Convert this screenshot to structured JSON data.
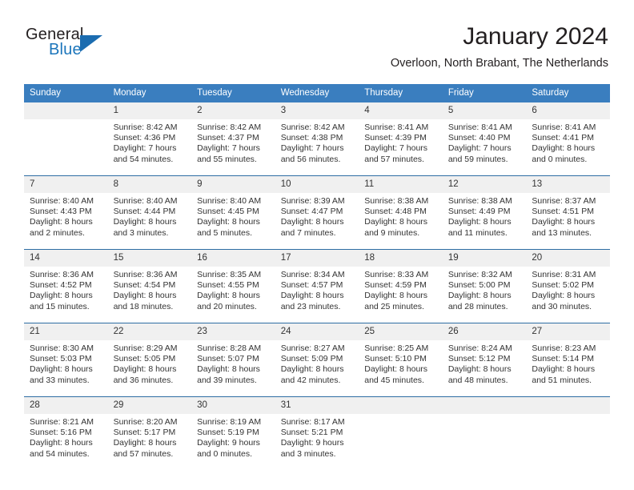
{
  "brand": {
    "name_part1": "General",
    "name_part2": "Blue"
  },
  "header": {
    "month_title": "January 2024",
    "location": "Overloon, North Brabant, The Netherlands"
  },
  "colors": {
    "header_blue": "#3a7ebf",
    "separator_blue": "#2e6da4",
    "date_band_gray": "#f0f0f0",
    "brand_blue": "#1b75bb"
  },
  "calendar": {
    "weekday_headers": [
      "Sunday",
      "Monday",
      "Tuesday",
      "Wednesday",
      "Thursday",
      "Friday",
      "Saturday"
    ],
    "weeks": [
      {
        "days": [
          {
            "date": "",
            "sunrise": "",
            "sunset": "",
            "daylight_line1": "",
            "daylight_line2": ""
          },
          {
            "date": "1",
            "sunrise": "Sunrise: 8:42 AM",
            "sunset": "Sunset: 4:36 PM",
            "daylight_line1": "Daylight: 7 hours",
            "daylight_line2": "and 54 minutes."
          },
          {
            "date": "2",
            "sunrise": "Sunrise: 8:42 AM",
            "sunset": "Sunset: 4:37 PM",
            "daylight_line1": "Daylight: 7 hours",
            "daylight_line2": "and 55 minutes."
          },
          {
            "date": "3",
            "sunrise": "Sunrise: 8:42 AM",
            "sunset": "Sunset: 4:38 PM",
            "daylight_line1": "Daylight: 7 hours",
            "daylight_line2": "and 56 minutes."
          },
          {
            "date": "4",
            "sunrise": "Sunrise: 8:41 AM",
            "sunset": "Sunset: 4:39 PM",
            "daylight_line1": "Daylight: 7 hours",
            "daylight_line2": "and 57 minutes."
          },
          {
            "date": "5",
            "sunrise": "Sunrise: 8:41 AM",
            "sunset": "Sunset: 4:40 PM",
            "daylight_line1": "Daylight: 7 hours",
            "daylight_line2": "and 59 minutes."
          },
          {
            "date": "6",
            "sunrise": "Sunrise: 8:41 AM",
            "sunset": "Sunset: 4:41 PM",
            "daylight_line1": "Daylight: 8 hours",
            "daylight_line2": "and 0 minutes."
          }
        ]
      },
      {
        "days": [
          {
            "date": "7",
            "sunrise": "Sunrise: 8:40 AM",
            "sunset": "Sunset: 4:43 PM",
            "daylight_line1": "Daylight: 8 hours",
            "daylight_line2": "and 2 minutes."
          },
          {
            "date": "8",
            "sunrise": "Sunrise: 8:40 AM",
            "sunset": "Sunset: 4:44 PM",
            "daylight_line1": "Daylight: 8 hours",
            "daylight_line2": "and 3 minutes."
          },
          {
            "date": "9",
            "sunrise": "Sunrise: 8:40 AM",
            "sunset": "Sunset: 4:45 PM",
            "daylight_line1": "Daylight: 8 hours",
            "daylight_line2": "and 5 minutes."
          },
          {
            "date": "10",
            "sunrise": "Sunrise: 8:39 AM",
            "sunset": "Sunset: 4:47 PM",
            "daylight_line1": "Daylight: 8 hours",
            "daylight_line2": "and 7 minutes."
          },
          {
            "date": "11",
            "sunrise": "Sunrise: 8:38 AM",
            "sunset": "Sunset: 4:48 PM",
            "daylight_line1": "Daylight: 8 hours",
            "daylight_line2": "and 9 minutes."
          },
          {
            "date": "12",
            "sunrise": "Sunrise: 8:38 AM",
            "sunset": "Sunset: 4:49 PM",
            "daylight_line1": "Daylight: 8 hours",
            "daylight_line2": "and 11 minutes."
          },
          {
            "date": "13",
            "sunrise": "Sunrise: 8:37 AM",
            "sunset": "Sunset: 4:51 PM",
            "daylight_line1": "Daylight: 8 hours",
            "daylight_line2": "and 13 minutes."
          }
        ]
      },
      {
        "days": [
          {
            "date": "14",
            "sunrise": "Sunrise: 8:36 AM",
            "sunset": "Sunset: 4:52 PM",
            "daylight_line1": "Daylight: 8 hours",
            "daylight_line2": "and 15 minutes."
          },
          {
            "date": "15",
            "sunrise": "Sunrise: 8:36 AM",
            "sunset": "Sunset: 4:54 PM",
            "daylight_line1": "Daylight: 8 hours",
            "daylight_line2": "and 18 minutes."
          },
          {
            "date": "16",
            "sunrise": "Sunrise: 8:35 AM",
            "sunset": "Sunset: 4:55 PM",
            "daylight_line1": "Daylight: 8 hours",
            "daylight_line2": "and 20 minutes."
          },
          {
            "date": "17",
            "sunrise": "Sunrise: 8:34 AM",
            "sunset": "Sunset: 4:57 PM",
            "daylight_line1": "Daylight: 8 hours",
            "daylight_line2": "and 23 minutes."
          },
          {
            "date": "18",
            "sunrise": "Sunrise: 8:33 AM",
            "sunset": "Sunset: 4:59 PM",
            "daylight_line1": "Daylight: 8 hours",
            "daylight_line2": "and 25 minutes."
          },
          {
            "date": "19",
            "sunrise": "Sunrise: 8:32 AM",
            "sunset": "Sunset: 5:00 PM",
            "daylight_line1": "Daylight: 8 hours",
            "daylight_line2": "and 28 minutes."
          },
          {
            "date": "20",
            "sunrise": "Sunrise: 8:31 AM",
            "sunset": "Sunset: 5:02 PM",
            "daylight_line1": "Daylight: 8 hours",
            "daylight_line2": "and 30 minutes."
          }
        ]
      },
      {
        "days": [
          {
            "date": "21",
            "sunrise": "Sunrise: 8:30 AM",
            "sunset": "Sunset: 5:03 PM",
            "daylight_line1": "Daylight: 8 hours",
            "daylight_line2": "and 33 minutes."
          },
          {
            "date": "22",
            "sunrise": "Sunrise: 8:29 AM",
            "sunset": "Sunset: 5:05 PM",
            "daylight_line1": "Daylight: 8 hours",
            "daylight_line2": "and 36 minutes."
          },
          {
            "date": "23",
            "sunrise": "Sunrise: 8:28 AM",
            "sunset": "Sunset: 5:07 PM",
            "daylight_line1": "Daylight: 8 hours",
            "daylight_line2": "and 39 minutes."
          },
          {
            "date": "24",
            "sunrise": "Sunrise: 8:27 AM",
            "sunset": "Sunset: 5:09 PM",
            "daylight_line1": "Daylight: 8 hours",
            "daylight_line2": "and 42 minutes."
          },
          {
            "date": "25",
            "sunrise": "Sunrise: 8:25 AM",
            "sunset": "Sunset: 5:10 PM",
            "daylight_line1": "Daylight: 8 hours",
            "daylight_line2": "and 45 minutes."
          },
          {
            "date": "26",
            "sunrise": "Sunrise: 8:24 AM",
            "sunset": "Sunset: 5:12 PM",
            "daylight_line1": "Daylight: 8 hours",
            "daylight_line2": "and 48 minutes."
          },
          {
            "date": "27",
            "sunrise": "Sunrise: 8:23 AM",
            "sunset": "Sunset: 5:14 PM",
            "daylight_line1": "Daylight: 8 hours",
            "daylight_line2": "and 51 minutes."
          }
        ]
      },
      {
        "days": [
          {
            "date": "28",
            "sunrise": "Sunrise: 8:21 AM",
            "sunset": "Sunset: 5:16 PM",
            "daylight_line1": "Daylight: 8 hours",
            "daylight_line2": "and 54 minutes."
          },
          {
            "date": "29",
            "sunrise": "Sunrise: 8:20 AM",
            "sunset": "Sunset: 5:17 PM",
            "daylight_line1": "Daylight: 8 hours",
            "daylight_line2": "and 57 minutes."
          },
          {
            "date": "30",
            "sunrise": "Sunrise: 8:19 AM",
            "sunset": "Sunset: 5:19 PM",
            "daylight_line1": "Daylight: 9 hours",
            "daylight_line2": "and 0 minutes."
          },
          {
            "date": "31",
            "sunrise": "Sunrise: 8:17 AM",
            "sunset": "Sunset: 5:21 PM",
            "daylight_line1": "Daylight: 9 hours",
            "daylight_line2": "and 3 minutes."
          },
          {
            "date": "",
            "sunrise": "",
            "sunset": "",
            "daylight_line1": "",
            "daylight_line2": ""
          },
          {
            "date": "",
            "sunrise": "",
            "sunset": "",
            "daylight_line1": "",
            "daylight_line2": ""
          },
          {
            "date": "",
            "sunrise": "",
            "sunset": "",
            "daylight_line1": "",
            "daylight_line2": ""
          }
        ]
      }
    ]
  }
}
